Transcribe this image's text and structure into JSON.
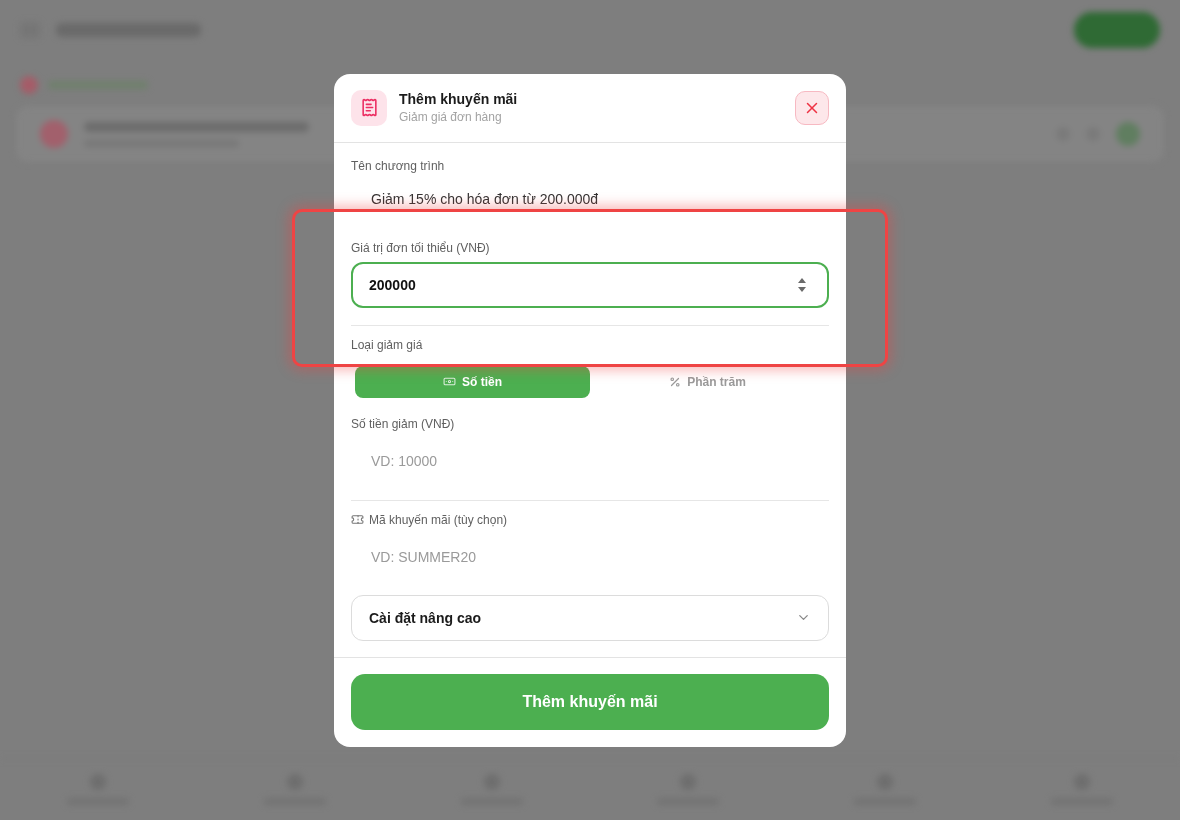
{
  "dialog": {
    "title": "Thêm khuyến mãi",
    "subtitle": "Giảm giá đơn hàng"
  },
  "sections": [
    {
      "fields": [
        {
          "kind": "text",
          "label": "Tên chương trình",
          "value": "Giảm 15% cho hóa đơn từ 200.000đ",
          "focused": false
        },
        {
          "kind": "number",
          "label": "Giá trị đơn tối thiểu (VNĐ)",
          "value": "200000",
          "focused": true
        }
      ]
    },
    {
      "fields": [
        {
          "kind": "segmented",
          "label": "Loại giảm giá",
          "options": [
            {
              "kind": "amount",
              "label": "Số tiền",
              "selected": true
            },
            {
              "kind": "percent",
              "label": "Phần trăm",
              "selected": false
            }
          ]
        },
        {
          "kind": "text",
          "label": "Số tiền giảm (VNĐ)",
          "placeholder": "VD: 10000",
          "focused": false
        }
      ]
    },
    {
      "fields": [
        {
          "kind": "code",
          "label": "Mã khuyến mãi (tùy chọn)",
          "placeholder": "VD: SUMMER20",
          "focused": false
        },
        {
          "kind": "collapsible",
          "label": "Cài đặt nâng cao",
          "expanded": false
        }
      ]
    }
  ],
  "submit_button": "Thêm khuyến mãi",
  "annotation": {
    "kind": "highlight-box"
  }
}
